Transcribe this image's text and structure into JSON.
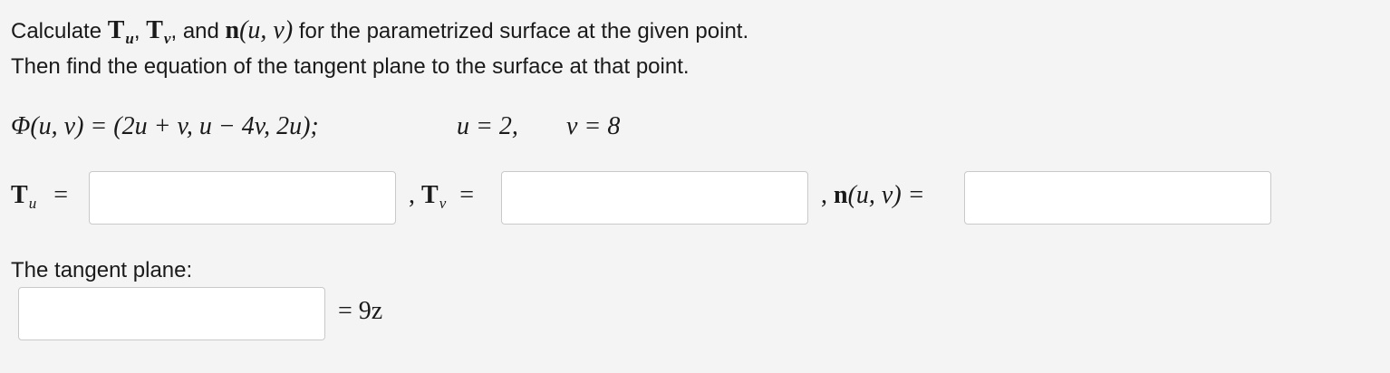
{
  "prompt": {
    "line1_calc": "Calculate",
    "T": "T",
    "sub_u": "u",
    "sub_v": "v",
    "comma": ",",
    "and": "and",
    "n_expr": "n",
    "n_args": "(u, v)",
    "line1_tail": "for the parametrized surface at the given point.",
    "line2": "Then find the equation of the tangent plane to the surface at that point."
  },
  "equation": {
    "phi": "Φ(u, v) = (2u + v, u − 4v, 2u);",
    "u_val": "u = 2,",
    "v_val": "v = 8"
  },
  "answers": {
    "Tu_label_T": "T",
    "Tu_label_sub": "u",
    "equals": "=",
    "Tv_prefix": ",",
    "Tv_label_T": "T",
    "Tv_label_sub": "v",
    "n_prefix": ",",
    "n_label": "n",
    "n_args": "(u, v) ="
  },
  "tangent": {
    "label": "The tangent plane:",
    "rhs": "= 9z"
  }
}
